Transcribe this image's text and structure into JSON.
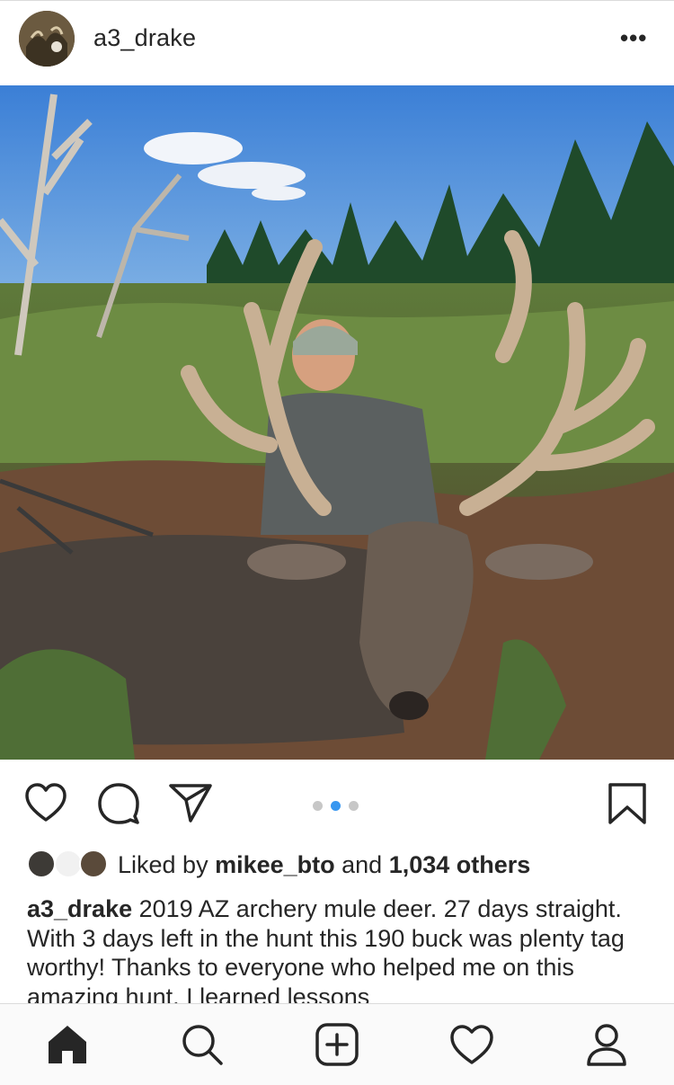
{
  "post": {
    "username": "a3_drake",
    "more_icon": "more-options-icon",
    "photo_icon": "photo-hunter-with-mule-deer",
    "carousel": {
      "count": 3,
      "active_index": 1
    }
  },
  "likes": {
    "prefix": "Liked by ",
    "liker": "mikee_bto",
    "middle": " and ",
    "others": "1,034 others"
  },
  "caption": {
    "username": "a3_drake",
    "text": " 2019 AZ archery mule deer. 27 days straight. With 3 days left in the hunt this 190 buck was plenty tag worthy! Thanks to everyone who helped me on this amazing hunt. I learned lessons"
  },
  "actions": {
    "icons": [
      "heart-icon",
      "comment-icon",
      "share-icon",
      "bookmark-icon"
    ]
  },
  "tabbar": {
    "icons": [
      "home-icon",
      "search-icon",
      "add-post-icon",
      "activity-heart-icon",
      "profile-icon"
    ],
    "active": "home-icon"
  },
  "colors": {
    "accent": "#3897f0",
    "text": "#262626",
    "divider": "#dbdbdb"
  }
}
